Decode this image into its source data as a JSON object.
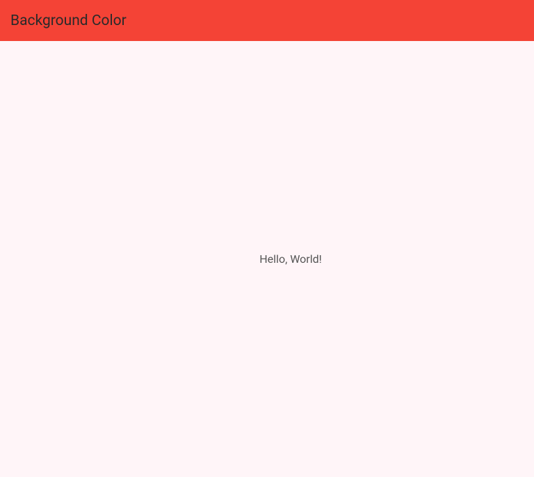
{
  "header": {
    "title": "Background Color"
  },
  "main": {
    "message": "Hello, World!"
  },
  "colors": {
    "app_bar": "#f44336",
    "background": "#fff5f8"
  }
}
